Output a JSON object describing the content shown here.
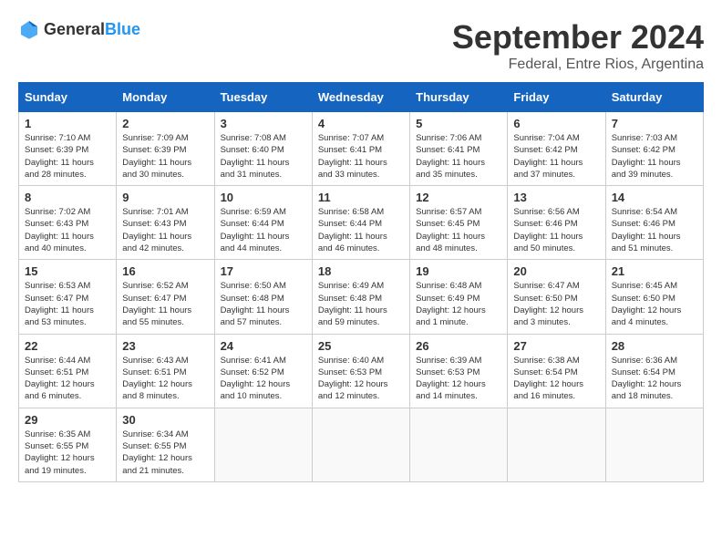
{
  "header": {
    "logo_general": "General",
    "logo_blue": "Blue",
    "title": "September 2024",
    "subtitle": "Federal, Entre Rios, Argentina"
  },
  "columns": [
    "Sunday",
    "Monday",
    "Tuesday",
    "Wednesday",
    "Thursday",
    "Friday",
    "Saturday"
  ],
  "weeks": [
    [
      {
        "day": "1",
        "sunrise": "7:10 AM",
        "sunset": "6:39 PM",
        "daylight": "11 hours and 28 minutes."
      },
      {
        "day": "2",
        "sunrise": "7:09 AM",
        "sunset": "6:39 PM",
        "daylight": "11 hours and 30 minutes."
      },
      {
        "day": "3",
        "sunrise": "7:08 AM",
        "sunset": "6:40 PM",
        "daylight": "11 hours and 31 minutes."
      },
      {
        "day": "4",
        "sunrise": "7:07 AM",
        "sunset": "6:41 PM",
        "daylight": "11 hours and 33 minutes."
      },
      {
        "day": "5",
        "sunrise": "7:06 AM",
        "sunset": "6:41 PM",
        "daylight": "11 hours and 35 minutes."
      },
      {
        "day": "6",
        "sunrise": "7:04 AM",
        "sunset": "6:42 PM",
        "daylight": "11 hours and 37 minutes."
      },
      {
        "day": "7",
        "sunrise": "7:03 AM",
        "sunset": "6:42 PM",
        "daylight": "11 hours and 39 minutes."
      }
    ],
    [
      {
        "day": "8",
        "sunrise": "7:02 AM",
        "sunset": "6:43 PM",
        "daylight": "11 hours and 40 minutes."
      },
      {
        "day": "9",
        "sunrise": "7:01 AM",
        "sunset": "6:43 PM",
        "daylight": "11 hours and 42 minutes."
      },
      {
        "day": "10",
        "sunrise": "6:59 AM",
        "sunset": "6:44 PM",
        "daylight": "11 hours and 44 minutes."
      },
      {
        "day": "11",
        "sunrise": "6:58 AM",
        "sunset": "6:44 PM",
        "daylight": "11 hours and 46 minutes."
      },
      {
        "day": "12",
        "sunrise": "6:57 AM",
        "sunset": "6:45 PM",
        "daylight": "11 hours and 48 minutes."
      },
      {
        "day": "13",
        "sunrise": "6:56 AM",
        "sunset": "6:46 PM",
        "daylight": "11 hours and 50 minutes."
      },
      {
        "day": "14",
        "sunrise": "6:54 AM",
        "sunset": "6:46 PM",
        "daylight": "11 hours and 51 minutes."
      }
    ],
    [
      {
        "day": "15",
        "sunrise": "6:53 AM",
        "sunset": "6:47 PM",
        "daylight": "11 hours and 53 minutes."
      },
      {
        "day": "16",
        "sunrise": "6:52 AM",
        "sunset": "6:47 PM",
        "daylight": "11 hours and 55 minutes."
      },
      {
        "day": "17",
        "sunrise": "6:50 AM",
        "sunset": "6:48 PM",
        "daylight": "11 hours and 57 minutes."
      },
      {
        "day": "18",
        "sunrise": "6:49 AM",
        "sunset": "6:48 PM",
        "daylight": "11 hours and 59 minutes."
      },
      {
        "day": "19",
        "sunrise": "6:48 AM",
        "sunset": "6:49 PM",
        "daylight": "12 hours and 1 minute."
      },
      {
        "day": "20",
        "sunrise": "6:47 AM",
        "sunset": "6:50 PM",
        "daylight": "12 hours and 3 minutes."
      },
      {
        "day": "21",
        "sunrise": "6:45 AM",
        "sunset": "6:50 PM",
        "daylight": "12 hours and 4 minutes."
      }
    ],
    [
      {
        "day": "22",
        "sunrise": "6:44 AM",
        "sunset": "6:51 PM",
        "daylight": "12 hours and 6 minutes."
      },
      {
        "day": "23",
        "sunrise": "6:43 AM",
        "sunset": "6:51 PM",
        "daylight": "12 hours and 8 minutes."
      },
      {
        "day": "24",
        "sunrise": "6:41 AM",
        "sunset": "6:52 PM",
        "daylight": "12 hours and 10 minutes."
      },
      {
        "day": "25",
        "sunrise": "6:40 AM",
        "sunset": "6:53 PM",
        "daylight": "12 hours and 12 minutes."
      },
      {
        "day": "26",
        "sunrise": "6:39 AM",
        "sunset": "6:53 PM",
        "daylight": "12 hours and 14 minutes."
      },
      {
        "day": "27",
        "sunrise": "6:38 AM",
        "sunset": "6:54 PM",
        "daylight": "12 hours and 16 minutes."
      },
      {
        "day": "28",
        "sunrise": "6:36 AM",
        "sunset": "6:54 PM",
        "daylight": "12 hours and 18 minutes."
      }
    ],
    [
      {
        "day": "29",
        "sunrise": "6:35 AM",
        "sunset": "6:55 PM",
        "daylight": "12 hours and 19 minutes."
      },
      {
        "day": "30",
        "sunrise": "6:34 AM",
        "sunset": "6:55 PM",
        "daylight": "12 hours and 21 minutes."
      },
      null,
      null,
      null,
      null,
      null
    ]
  ]
}
